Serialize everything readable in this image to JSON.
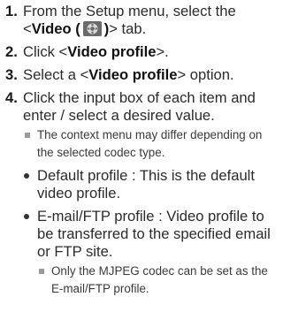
{
  "steps": [
    {
      "num": "1.",
      "text_a": "From the Setup menu, select the",
      "text_b_pre": "<",
      "text_b_bold": "Video (",
      "text_b_bold_end": ")",
      "text_b_post": "> tab.",
      "icon": "video-camera-icon"
    },
    {
      "num": "2.",
      "pre": "Click <",
      "bold": "Video profile",
      "post": ">."
    },
    {
      "num": "3.",
      "pre": "Select a <",
      "bold": "Video profile",
      "post": "> option."
    },
    {
      "num": "4.",
      "text": "Click the input box of each item and enter / select a desired value.",
      "note": "The context menu may differ depending on the selected codec type.",
      "bullets": [
        {
          "text": "Default profile : This is the default video profile."
        },
        {
          "text": "E-mail/FTP profile : Video profile to be transferred to the specified email or FTP site.",
          "note": "Only the MJPEG codec can be set as the E-mail/FTP profile."
        }
      ]
    }
  ],
  "colors": {
    "text": "#2b2b2b",
    "icon_bg": "#6a6a6a",
    "note_marker": "#9a9a9a"
  }
}
